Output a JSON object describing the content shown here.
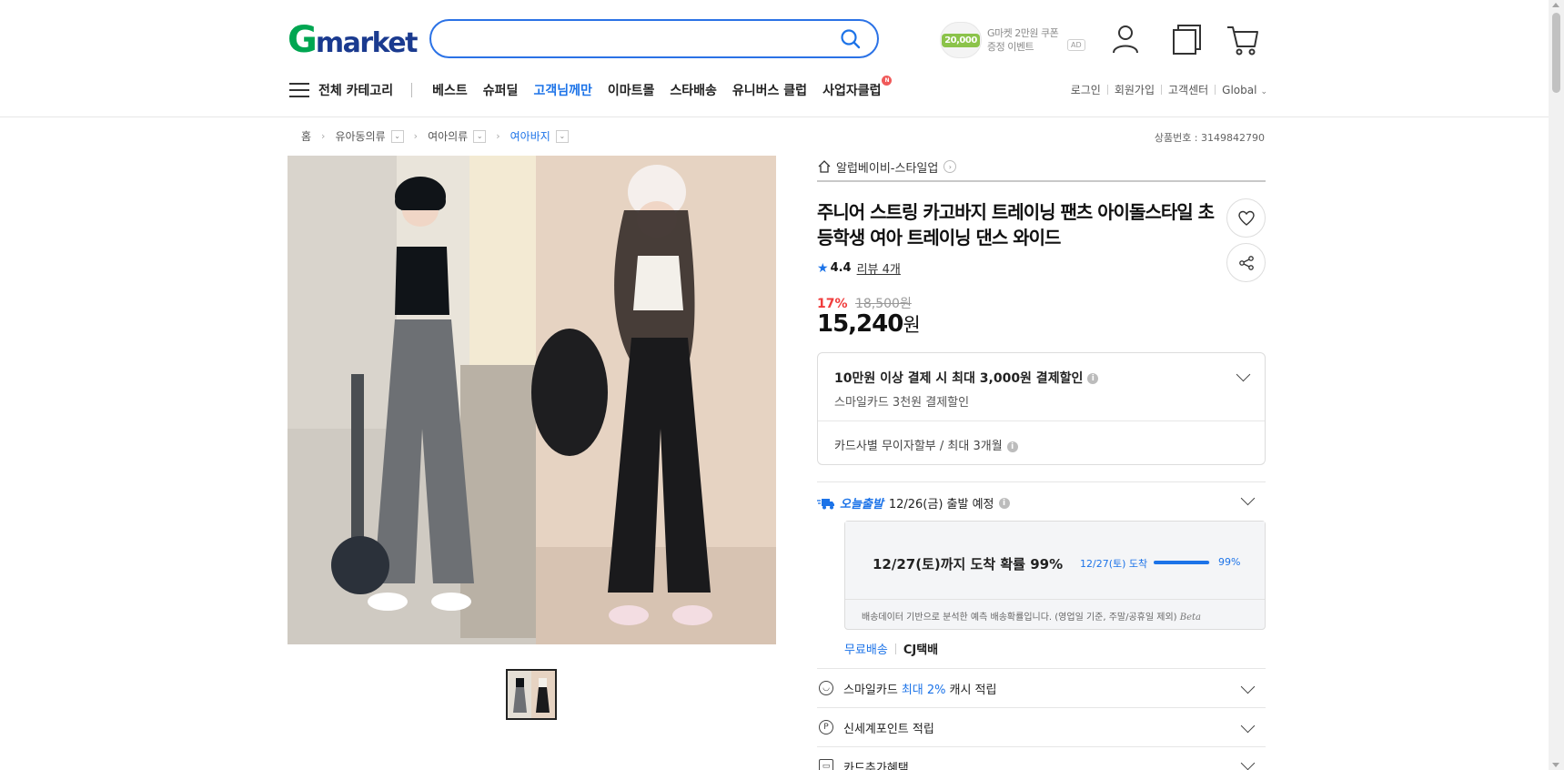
{
  "header": {
    "logo_g": "G",
    "logo_rest": "market",
    "search_placeholder": "",
    "coupon_amount": "20,000",
    "coupon_line1": "G마켓 2만원 쿠폰",
    "coupon_line2": "증정 이벤트",
    "ad_label": "AD"
  },
  "nav": {
    "all_categories": "전체 카테고리",
    "items": [
      "베스트",
      "슈퍼딜",
      "고객님께만",
      "이마트몰",
      "스타배송",
      "유니버스 클럽",
      "사업자클럽"
    ],
    "new_badge": "N",
    "util": [
      "로그인",
      "회원가입",
      "고객센터",
      "Global"
    ]
  },
  "breadcrumb": {
    "home": "홈",
    "level1": "유아동의류",
    "level2": "여아의류",
    "level3": "여아바지"
  },
  "product_number": "상품번호 : 3149842790",
  "seller": "알럽베이비-스타일업",
  "product": {
    "title": "주니어 스트링 카고바지 트레이닝 팬츠 아이돌스타일 초등학생 여아 트레이닝 댄스 와이드",
    "rating": "4.4",
    "review_link": "리뷰 4개",
    "discount_pct": "17%",
    "original_price": "18,500원",
    "price_number": "15,240",
    "price_unit": "원"
  },
  "payment": {
    "main": "10만원 이상 결제 시 최대 3,000원 결제할인",
    "sub": "스마일카드 3천원 결제할인",
    "installment": "카드사별 무이자할부 / 최대 3개월"
  },
  "shipping": {
    "today_label": "오늘출발",
    "schedule": "12/26(금) 출발 예정",
    "arrival_headline": "12/27(토)까지 도착 확률 99%",
    "arrival_label": "12/27(토) 도착",
    "arrival_probability": 0.99,
    "arrival_pct_text": "99%",
    "note": "배송데이터 기반으로 분석한 예측 배송확률입니다. (영업일 기준, 주말/공휴일 제외)",
    "beta": "Beta",
    "free_shipping": "무료배송",
    "carrier": "CJ택배"
  },
  "benefits": {
    "smile_prefix": "스마일카드",
    "smile_highlight": "최대 2%",
    "smile_suffix": "캐시 적립",
    "shinsegae": "신세계포인트 적립",
    "card_extra": "카드추가혜택"
  },
  "colors": {
    "accent": "#1c73e8",
    "discount": "#f03c3c",
    "logo_green": "#00a651",
    "logo_navy": "#1a3a8f"
  }
}
